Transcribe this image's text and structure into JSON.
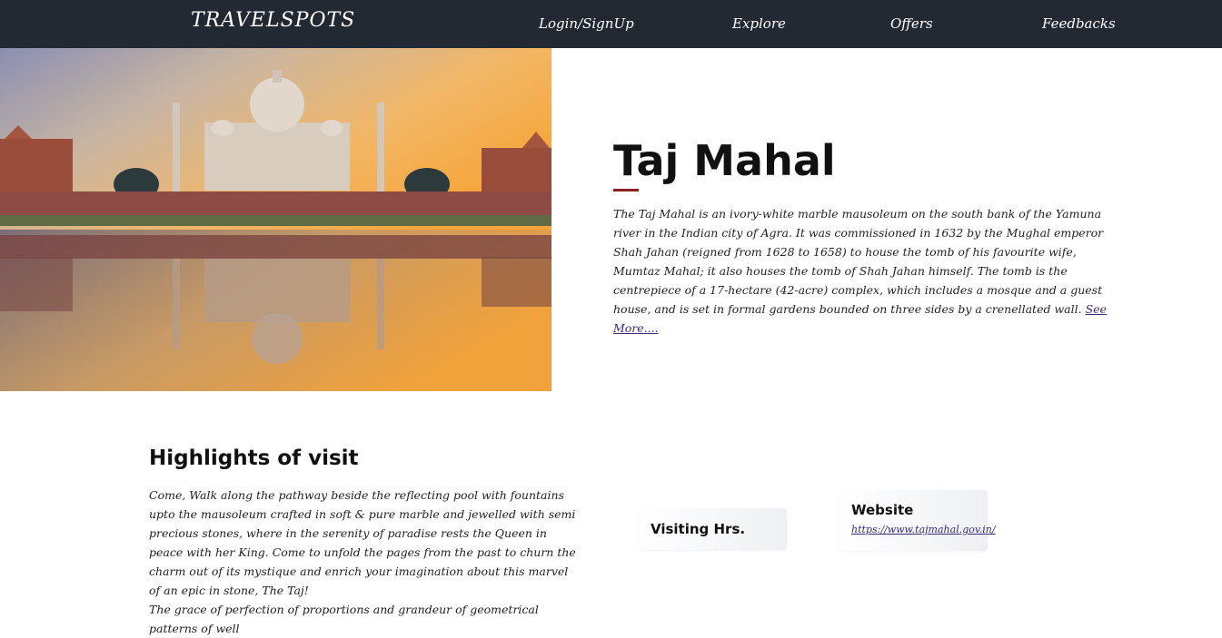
{
  "header": {
    "brand": "TRAVELSPOTS",
    "nav": [
      {
        "label": "Login/SignUp"
      },
      {
        "label": "Explore"
      },
      {
        "label": "Offers"
      },
      {
        "label": "Feedbacks"
      }
    ]
  },
  "hero": {
    "image": "taj-mahal-photo",
    "title": "Taj Mahal",
    "description": "The Taj Mahal is an ivory-white marble mausoleum on the south bank of the Yamuna river in the Indian city of Agra. It was commissioned in 1632 by the Mughal emperor Shah Jahan (reigned from 1628 to 1658) to house the tomb of his favourite wife, Mumtaz Mahal; it also houses the tomb of Shah Jahan himself. The tomb is the centrepiece of a 17-hectare (42-acre) complex, which includes a mosque and a guest house, and is set in formal gardens bounded on three sides by a crenellated wall.",
    "see_more": "See More....",
    "accent_color": "#8c1f1f"
  },
  "highlights": {
    "title": "Highlights of visit",
    "text_1": "Come, Walk along the pathway beside the reflecting pool with fountains upto the mausoleum crafted in soft & pure marble and jewelled with semi precious stones, where in the serenity of paradise rests the Queen in peace with her King. Come to unfold the pages from the past to churn the charm out of its mystique and enrich your imagination about this marvel of an epic in stone, The Taj!",
    "text_2": "The grace of perfection of proportions and grandeur of geometrical patterns of well"
  },
  "cards": {
    "visiting_label": "Visiting Hrs.",
    "website_label": "Website",
    "website_url": "https://www.tajmahal.gov.in/"
  },
  "colors": {
    "header_bg": "#232933",
    "link": "#3a2a7a"
  }
}
